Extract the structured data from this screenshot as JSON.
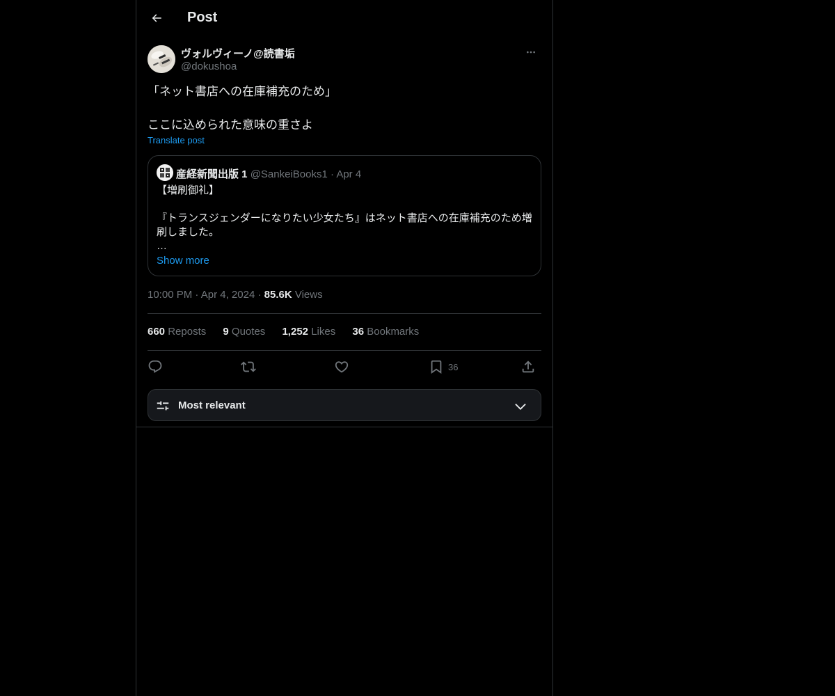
{
  "header": {
    "title": "Post",
    "back_icon": "arrow-left-icon"
  },
  "post": {
    "author": {
      "name": "ヴォルヴィーノ@読書垢",
      "handle": "@dokushoa"
    },
    "text_lines": [
      "「ネット書店への在庫補充のため」",
      "",
      "ここに込められた意味の重さよ"
    ],
    "translate_label": "Translate post",
    "quote": {
      "name": "産経新聞出版 1",
      "handle": "@SankeiBooks1",
      "separator": "·",
      "date": "Apr 4",
      "lines": [
        "【増刷御礼】",
        "",
        "『トランスジェンダーになりたい少女たち』はネット書店への在庫補充のため増",
        "刷しました。",
        "…"
      ],
      "show_more": "Show more"
    },
    "meta": {
      "time": "10:00 PM",
      "separator": "·",
      "date": "Apr 4, 2024",
      "views_count": "85.6K",
      "views_label": "Views"
    },
    "stats": [
      {
        "count": "660",
        "label": "Reposts"
      },
      {
        "count": "9",
        "label": "Quotes"
      },
      {
        "count": "1,252",
        "label": "Likes"
      },
      {
        "count": "36",
        "label": "Bookmarks"
      }
    ],
    "actions": {
      "reply_icon": "reply-icon",
      "repost_icon": "repost-icon",
      "like_icon": "heart-icon",
      "bookmark_icon": "bookmark-icon",
      "bookmark_count": "36",
      "share_icon": "share-icon"
    }
  },
  "sort": {
    "label": "Most relevant",
    "icon": "sliders-icon",
    "chevron": "chevron-down-icon"
  },
  "colors": {
    "background": "#000000",
    "text": "#e7e9ea",
    "muted": "#71767b",
    "accent": "#1d9bf0",
    "border": "#2f3336"
  }
}
